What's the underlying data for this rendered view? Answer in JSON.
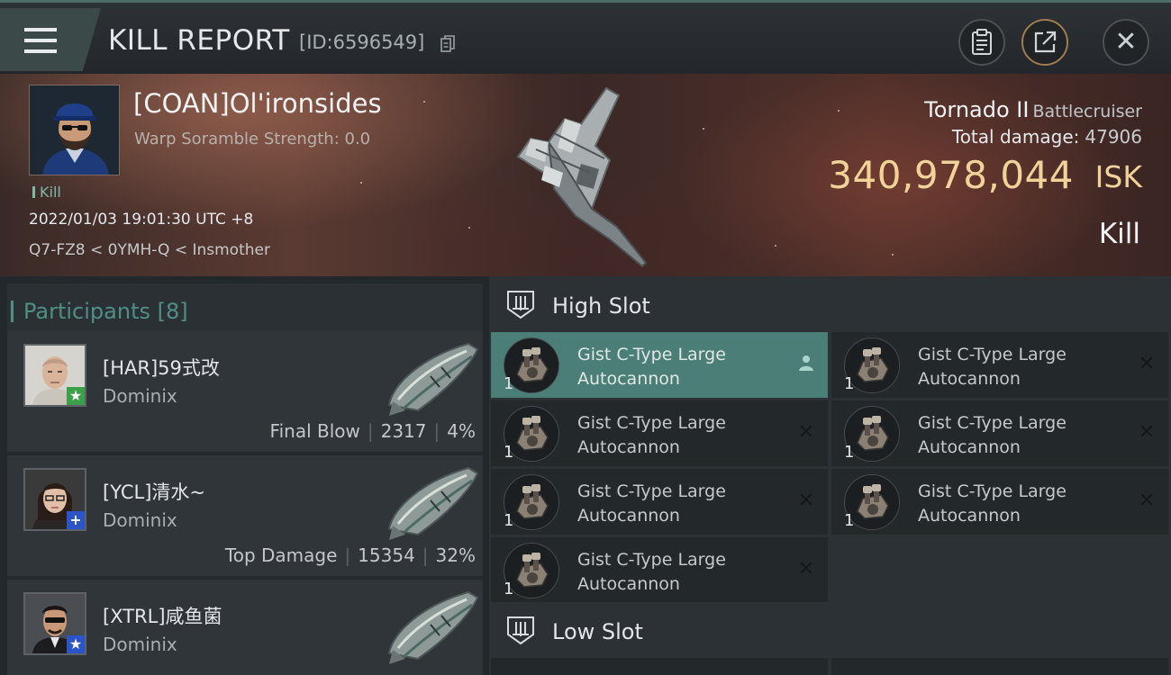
{
  "titlebar": {
    "title": "KILL REPORT",
    "report_id": "[ID:6596549]"
  },
  "victim": {
    "name": "[COAN]Ol'ironsides",
    "scramble": "Warp Soramble Strength: 0.0",
    "tag": "Kill",
    "time": "2022/01/03 19:01:30 UTC +8",
    "location": "Q7-FZ8 < 0YMH-Q < Insmother",
    "ship_name": "Tornado II",
    "ship_class": "Battlecruiser",
    "total_damage_label": "Total damage:",
    "total_damage": "47906",
    "isk_value": "340,978,044",
    "isk_unit": "ISK",
    "result": "Kill"
  },
  "participants": {
    "title": "Participants [8]",
    "items": [
      {
        "name": "[HAR]59式改",
        "ship": "Dominix",
        "role": "Final Blow",
        "damage": "2317",
        "percent": "4%",
        "badge": "★",
        "badge_color": "#3aa04a"
      },
      {
        "name": "[YCL]清水~",
        "ship": "Dominix",
        "role": "Top Damage",
        "damage": "15354",
        "percent": "32%",
        "badge": "+",
        "badge_color": "#2a54c8"
      },
      {
        "name": "[XTRL]咸鱼菌",
        "ship": "Dominix",
        "role": "",
        "damage": "",
        "percent": "",
        "badge": "★",
        "badge_color": "#2a54c8"
      }
    ]
  },
  "slots": {
    "high_label": "High Slot",
    "low_label": "Low Slot",
    "modules": [
      {
        "name": "Gist C-Type Large Autocannon",
        "qty": "1",
        "active": true,
        "action_icon": "person-icon"
      },
      {
        "name": "Gist C-Type Large Autocannon",
        "qty": "1",
        "active": false,
        "action_icon": "close-icon"
      },
      {
        "name": "Gist C-Type Large Autocannon",
        "qty": "1",
        "active": false,
        "action_icon": "close-icon"
      },
      {
        "name": "Gist C-Type Large Autocannon",
        "qty": "1",
        "active": false,
        "action_icon": "close-icon"
      },
      {
        "name": "Gist C-Type Large Autocannon",
        "qty": "1",
        "active": false,
        "action_icon": "close-icon"
      },
      {
        "name": "Gist C-Type Large Autocannon",
        "qty": "1",
        "active": false,
        "action_icon": "close-icon"
      },
      {
        "name": "Gist C-Type Large Autocannon",
        "qty": "1",
        "active": false,
        "action_icon": "close-icon"
      }
    ]
  },
  "colors": {
    "accent": "#4b7e76",
    "isk": "#f1d39a",
    "participants_title": "#4f8f86"
  }
}
